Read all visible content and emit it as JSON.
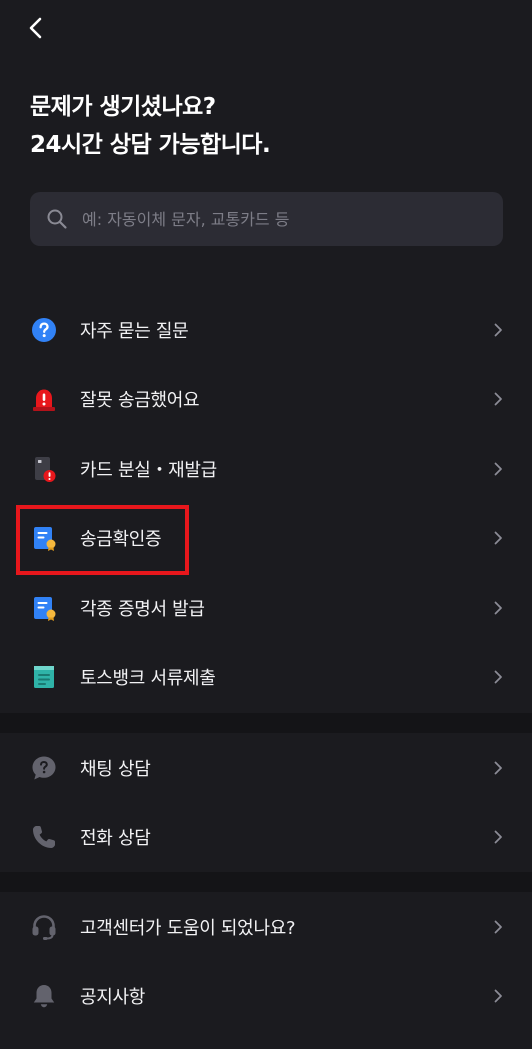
{
  "header": {
    "back_icon": "chevron-left-icon",
    "title_line1": "문제가 생기셨나요?",
    "title_line2": "24시간 상담 가능합니다."
  },
  "search": {
    "placeholder": "예: 자동이체 문자, 교통카드 등",
    "icon": "search-icon"
  },
  "menu": {
    "items": [
      {
        "label": "자주 묻는 질문",
        "icon": "question-circle-icon"
      },
      {
        "label": "잘못 송금했어요",
        "icon": "alarm-siren-icon"
      },
      {
        "label": "카드 분실・재발급",
        "icon": "lost-card-icon"
      },
      {
        "label": "송금확인증",
        "icon": "certificate-document-icon"
      },
      {
        "label": "각종 증명서 발급",
        "icon": "certificate-document-icon"
      },
      {
        "label": "토스뱅크 서류제출",
        "icon": "document-submit-icon"
      }
    ]
  },
  "contact": {
    "items": [
      {
        "label": "채팅 상담",
        "icon": "chat-bubble-icon"
      },
      {
        "label": "전화 상담",
        "icon": "phone-icon"
      }
    ]
  },
  "misc": {
    "items": [
      {
        "label": "고객센터가 도움이 되었나요?",
        "icon": "headset-icon"
      },
      {
        "label": "공지사항",
        "icon": "bell-icon"
      }
    ]
  },
  "colors": {
    "background": "#1b1b1f",
    "search_bg": "#2c2c34",
    "divider": "#141417",
    "accent_blue": "#3182f6",
    "alert_red": "#e8171c",
    "highlight": "#e8171c"
  }
}
